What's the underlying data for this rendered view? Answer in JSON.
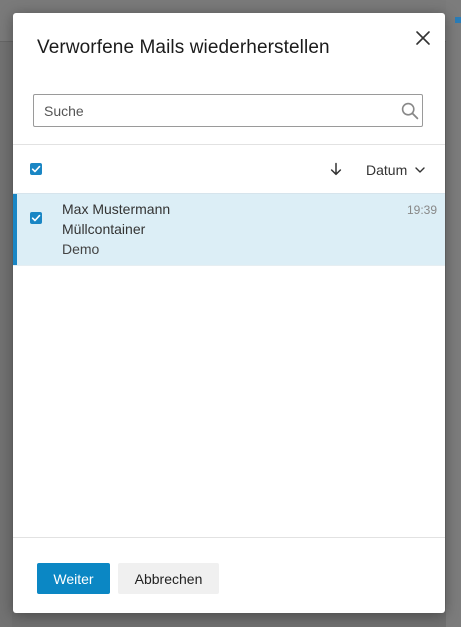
{
  "dialog": {
    "title": "Verworfene Mails wiederherstellen"
  },
  "search": {
    "value": "",
    "placeholder": "Suche"
  },
  "toolbar": {
    "select_all_checked": true,
    "sort_direction_icon": "arrow-down-icon",
    "sort_field_label": "Datum",
    "sort_field_icon": "chevron-down-icon"
  },
  "mails": [
    {
      "checked": true,
      "selected": true,
      "sender": "Max Mustermann",
      "subject": "Müllcontainer",
      "preview": "Demo",
      "time": "19:39"
    }
  ],
  "footer": {
    "continue_label": "Weiter",
    "cancel_label": "Abbrechen"
  },
  "colors": {
    "accent": "#1a86c4",
    "primary_button": "#0b87c4",
    "selected_row": "#dceef6",
    "overlay": "#6f6f6f"
  },
  "icons": {
    "close": "close-icon",
    "search": "search-icon",
    "checkbox": "checkmark-icon"
  }
}
